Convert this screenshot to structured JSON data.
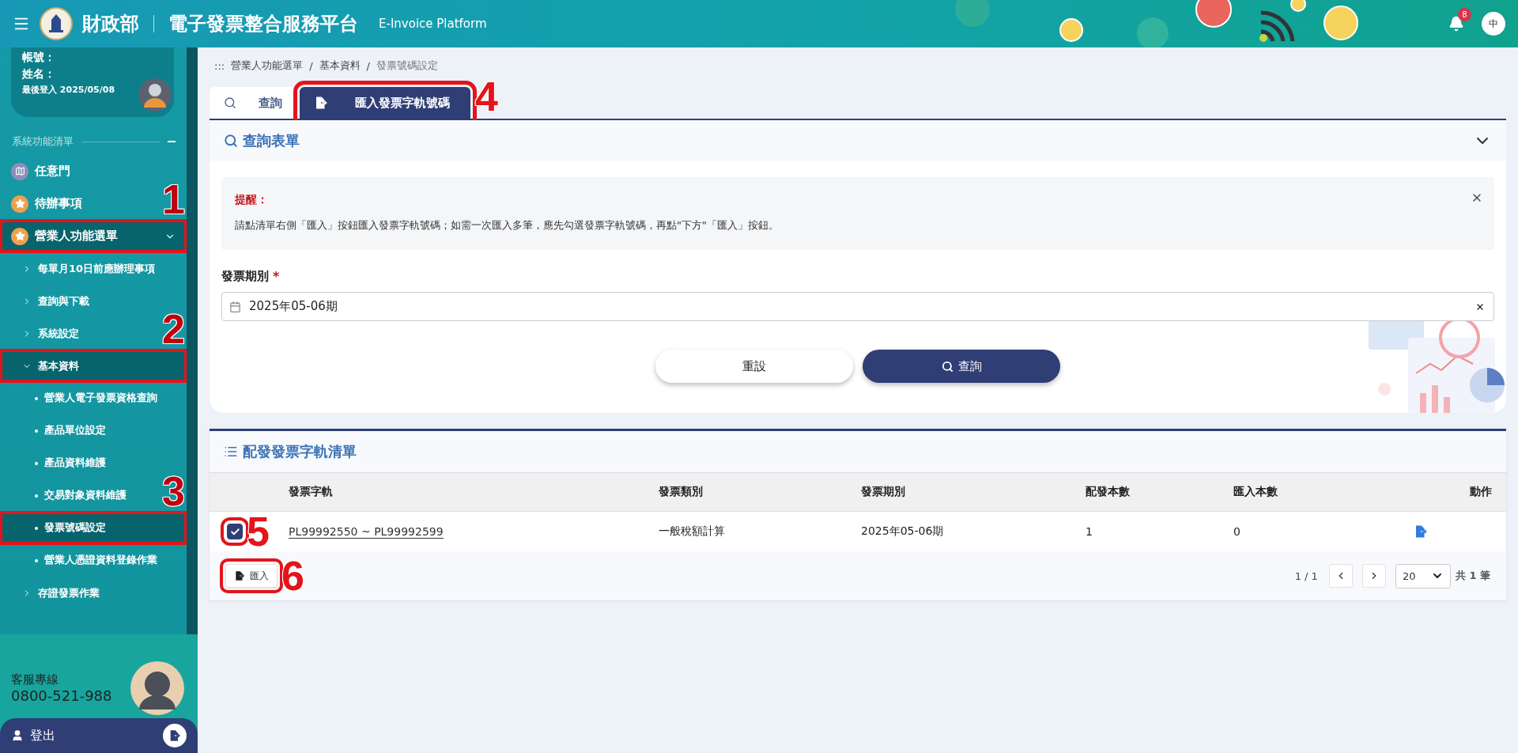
{
  "header": {
    "ministry": "財政部",
    "platform": "電子發票整合服務平台",
    "platform_en": "E-Invoice Platform",
    "notification_count": "8",
    "language": "中"
  },
  "user": {
    "account_label": "帳號：",
    "name_label": "姓名：",
    "last_login": "最後登入 2025/05/08"
  },
  "sidebar": {
    "section_title": "系統功能清單",
    "items": [
      {
        "label": "任意門",
        "selected": false
      },
      {
        "label": "待辦事項",
        "selected": false
      },
      {
        "label": "營業人功能選單",
        "selected": true,
        "expanded": true,
        "callout": "1",
        "children": [
          {
            "label": "每單月10日前應辦理事項",
            "selected": false,
            "expanded": false
          },
          {
            "label": "查詢與下載",
            "selected": false,
            "expanded": false
          },
          {
            "label": "系統設定",
            "selected": false,
            "expanded": false
          },
          {
            "label": "基本資料",
            "selected": true,
            "expanded": true,
            "callout": "2",
            "children": [
              {
                "label": "營業人電子發票資格查詢",
                "selected": false
              },
              {
                "label": "產品單位設定",
                "selected": false
              },
              {
                "label": "產品資料維護",
                "selected": false
              },
              {
                "label": "交易對象資料維護",
                "selected": false
              },
              {
                "label": "發票號碼設定",
                "selected": true,
                "callout": "3"
              },
              {
                "label": "營業人憑證資料登錄作業",
                "selected": false
              }
            ]
          },
          {
            "label": "存證發票作業",
            "selected": false,
            "expanded": false
          }
        ]
      }
    ]
  },
  "support": {
    "label": "客服專線",
    "phone": "0800-521-988"
  },
  "logout": {
    "label": "登出"
  },
  "breadcrumb": {
    "prefix": ":::",
    "separator": "/",
    "items": [
      "營業人功能選單",
      "基本資料",
      "發票號碼設定"
    ]
  },
  "tabs": [
    {
      "label": "查詢",
      "selected": false
    },
    {
      "label": "匯入發票字軌號碼",
      "selected": true,
      "callout": "4"
    }
  ],
  "query_form": {
    "title": "查詢表單",
    "expanded": true,
    "notice": {
      "title": "提醒：",
      "text": "請點清單右側「匯入」按鈕匯入發票字軌號碼；如需一次匯入多筆，應先勾選發票字軌號碼，再點\"下方\"「匯入」按鈕。"
    },
    "field": {
      "label": "發票期別",
      "required_mark": "*",
      "value": "2025年05-06期"
    },
    "buttons": [
      {
        "label": "重設",
        "kind": "secondary"
      },
      {
        "label": "查詢",
        "kind": "primary"
      }
    ]
  },
  "list": {
    "title": "配發發票字軌清單",
    "columns": [
      "發票字軌",
      "發票類別",
      "發票期別",
      "配發本數",
      "匯入本數",
      "動作"
    ],
    "rows": [
      {
        "checked": true,
        "callout": "5",
        "cells": [
          "PL99992550 ~ PL99992599",
          "一般稅額計算",
          "2025年05-06期",
          "1",
          "0"
        ]
      }
    ],
    "import_button": {
      "label": "匯入",
      "callout": "6"
    },
    "pagination": {
      "page": "1 / 1",
      "page_size": "20",
      "total": "共 1 筆"
    }
  }
}
